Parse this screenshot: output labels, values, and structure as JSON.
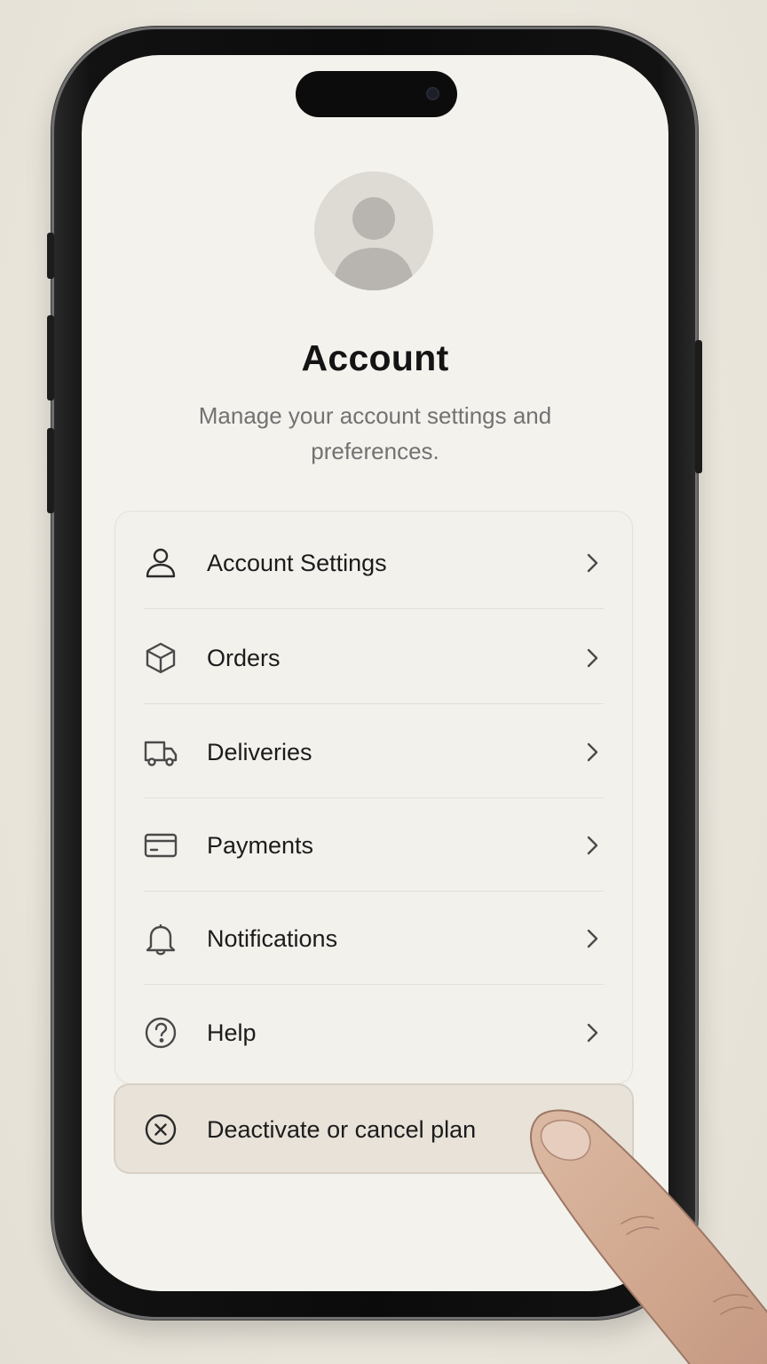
{
  "header": {
    "title": "Account",
    "subtitle": "Manage your account settings and preferences."
  },
  "avatar": {
    "icon": "user-avatar-icon"
  },
  "menu": {
    "items": [
      {
        "label": "Account Settings",
        "icon": "user-icon"
      },
      {
        "label": "Orders",
        "icon": "box-icon"
      },
      {
        "label": "Deliveries",
        "icon": "truck-icon"
      },
      {
        "label": "Payments",
        "icon": "credit-card-icon"
      },
      {
        "label": "Notifications",
        "icon": "bell-icon"
      },
      {
        "label": "Help",
        "icon": "help-circle-icon"
      }
    ]
  },
  "danger_action": {
    "label": "Deactivate or cancel plan",
    "icon": "x-circle-icon"
  },
  "colors": {
    "screen_background": "#f4f2ed",
    "text_primary": "#141414",
    "text_secondary": "#727272",
    "danger_button_background": "#e8e2d8"
  }
}
